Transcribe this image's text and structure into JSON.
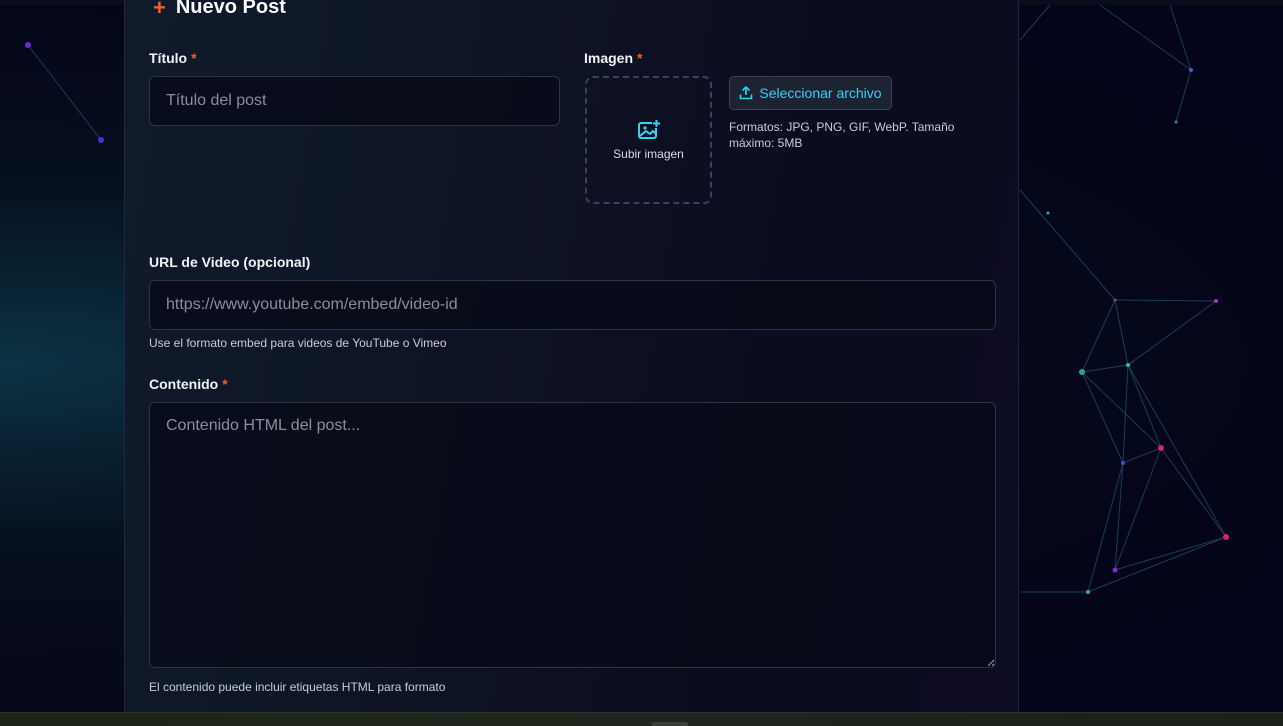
{
  "form": {
    "heading": "Nuevo Post",
    "required_mark": "*",
    "title": {
      "label": "Título",
      "placeholder": "Título del post",
      "value": ""
    },
    "image": {
      "label": "Imagen",
      "dropzone_label": "Subir imagen",
      "button_label": "Seleccionar archivo",
      "formats_text": "Formatos: JPG, PNG, GIF, WebP. Tamaño máximo: 5MB"
    },
    "video": {
      "label": "URL de Video (opcional)",
      "placeholder": "https://www.youtube.com/embed/video-id",
      "value": "",
      "help": "Use el formato embed para videos de YouTube o Vimeo"
    },
    "content": {
      "label": "Contenido",
      "placeholder": "Contenido HTML del post...",
      "value": "",
      "help": "El contenido puede incluir etiquetas HTML para formato"
    }
  },
  "icons": {
    "heading": "plus-icon",
    "dropzone": "image-add-icon",
    "button": "upload-icon"
  },
  "colors": {
    "accent_orange": "#ff5a1f",
    "accent_cyan": "#2fd4ee",
    "background": "#06061a"
  }
}
